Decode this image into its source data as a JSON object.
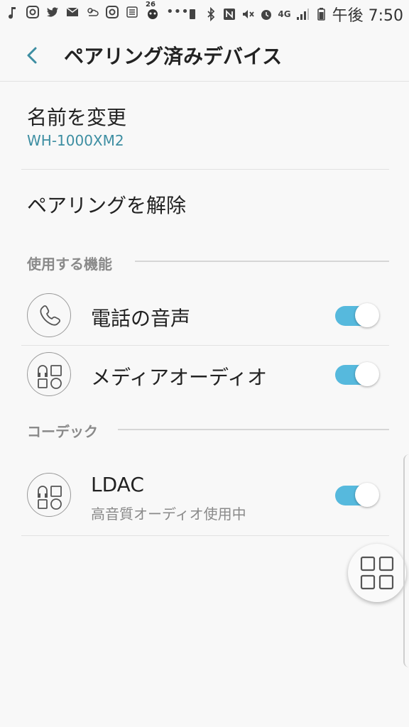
{
  "statusbar": {
    "network": "4G",
    "time": "午後 7:50",
    "notification_badge": "26"
  },
  "header": {
    "title": "ペアリング済みデバイス"
  },
  "rename": {
    "label": "名前を変更",
    "device_name": "WH-1000XM2"
  },
  "unpair": {
    "label": "ペアリングを解除"
  },
  "features_section": {
    "title": "使用する機能",
    "items": [
      {
        "label": "電話の音声",
        "icon": "phone-icon",
        "enabled": true
      },
      {
        "label": "メディアオーディオ",
        "icon": "headphones-grid-icon",
        "enabled": true
      }
    ]
  },
  "codec_section": {
    "title": "コーデック",
    "items": [
      {
        "label": "LDAC",
        "sublabel": "高音質オーディオ使用中",
        "icon": "headphones-grid-icon",
        "enabled": true
      }
    ]
  },
  "colors": {
    "accent": "#3d8ea2",
    "toggle_on": "#56b9dd",
    "background": "#f8f8f8"
  }
}
